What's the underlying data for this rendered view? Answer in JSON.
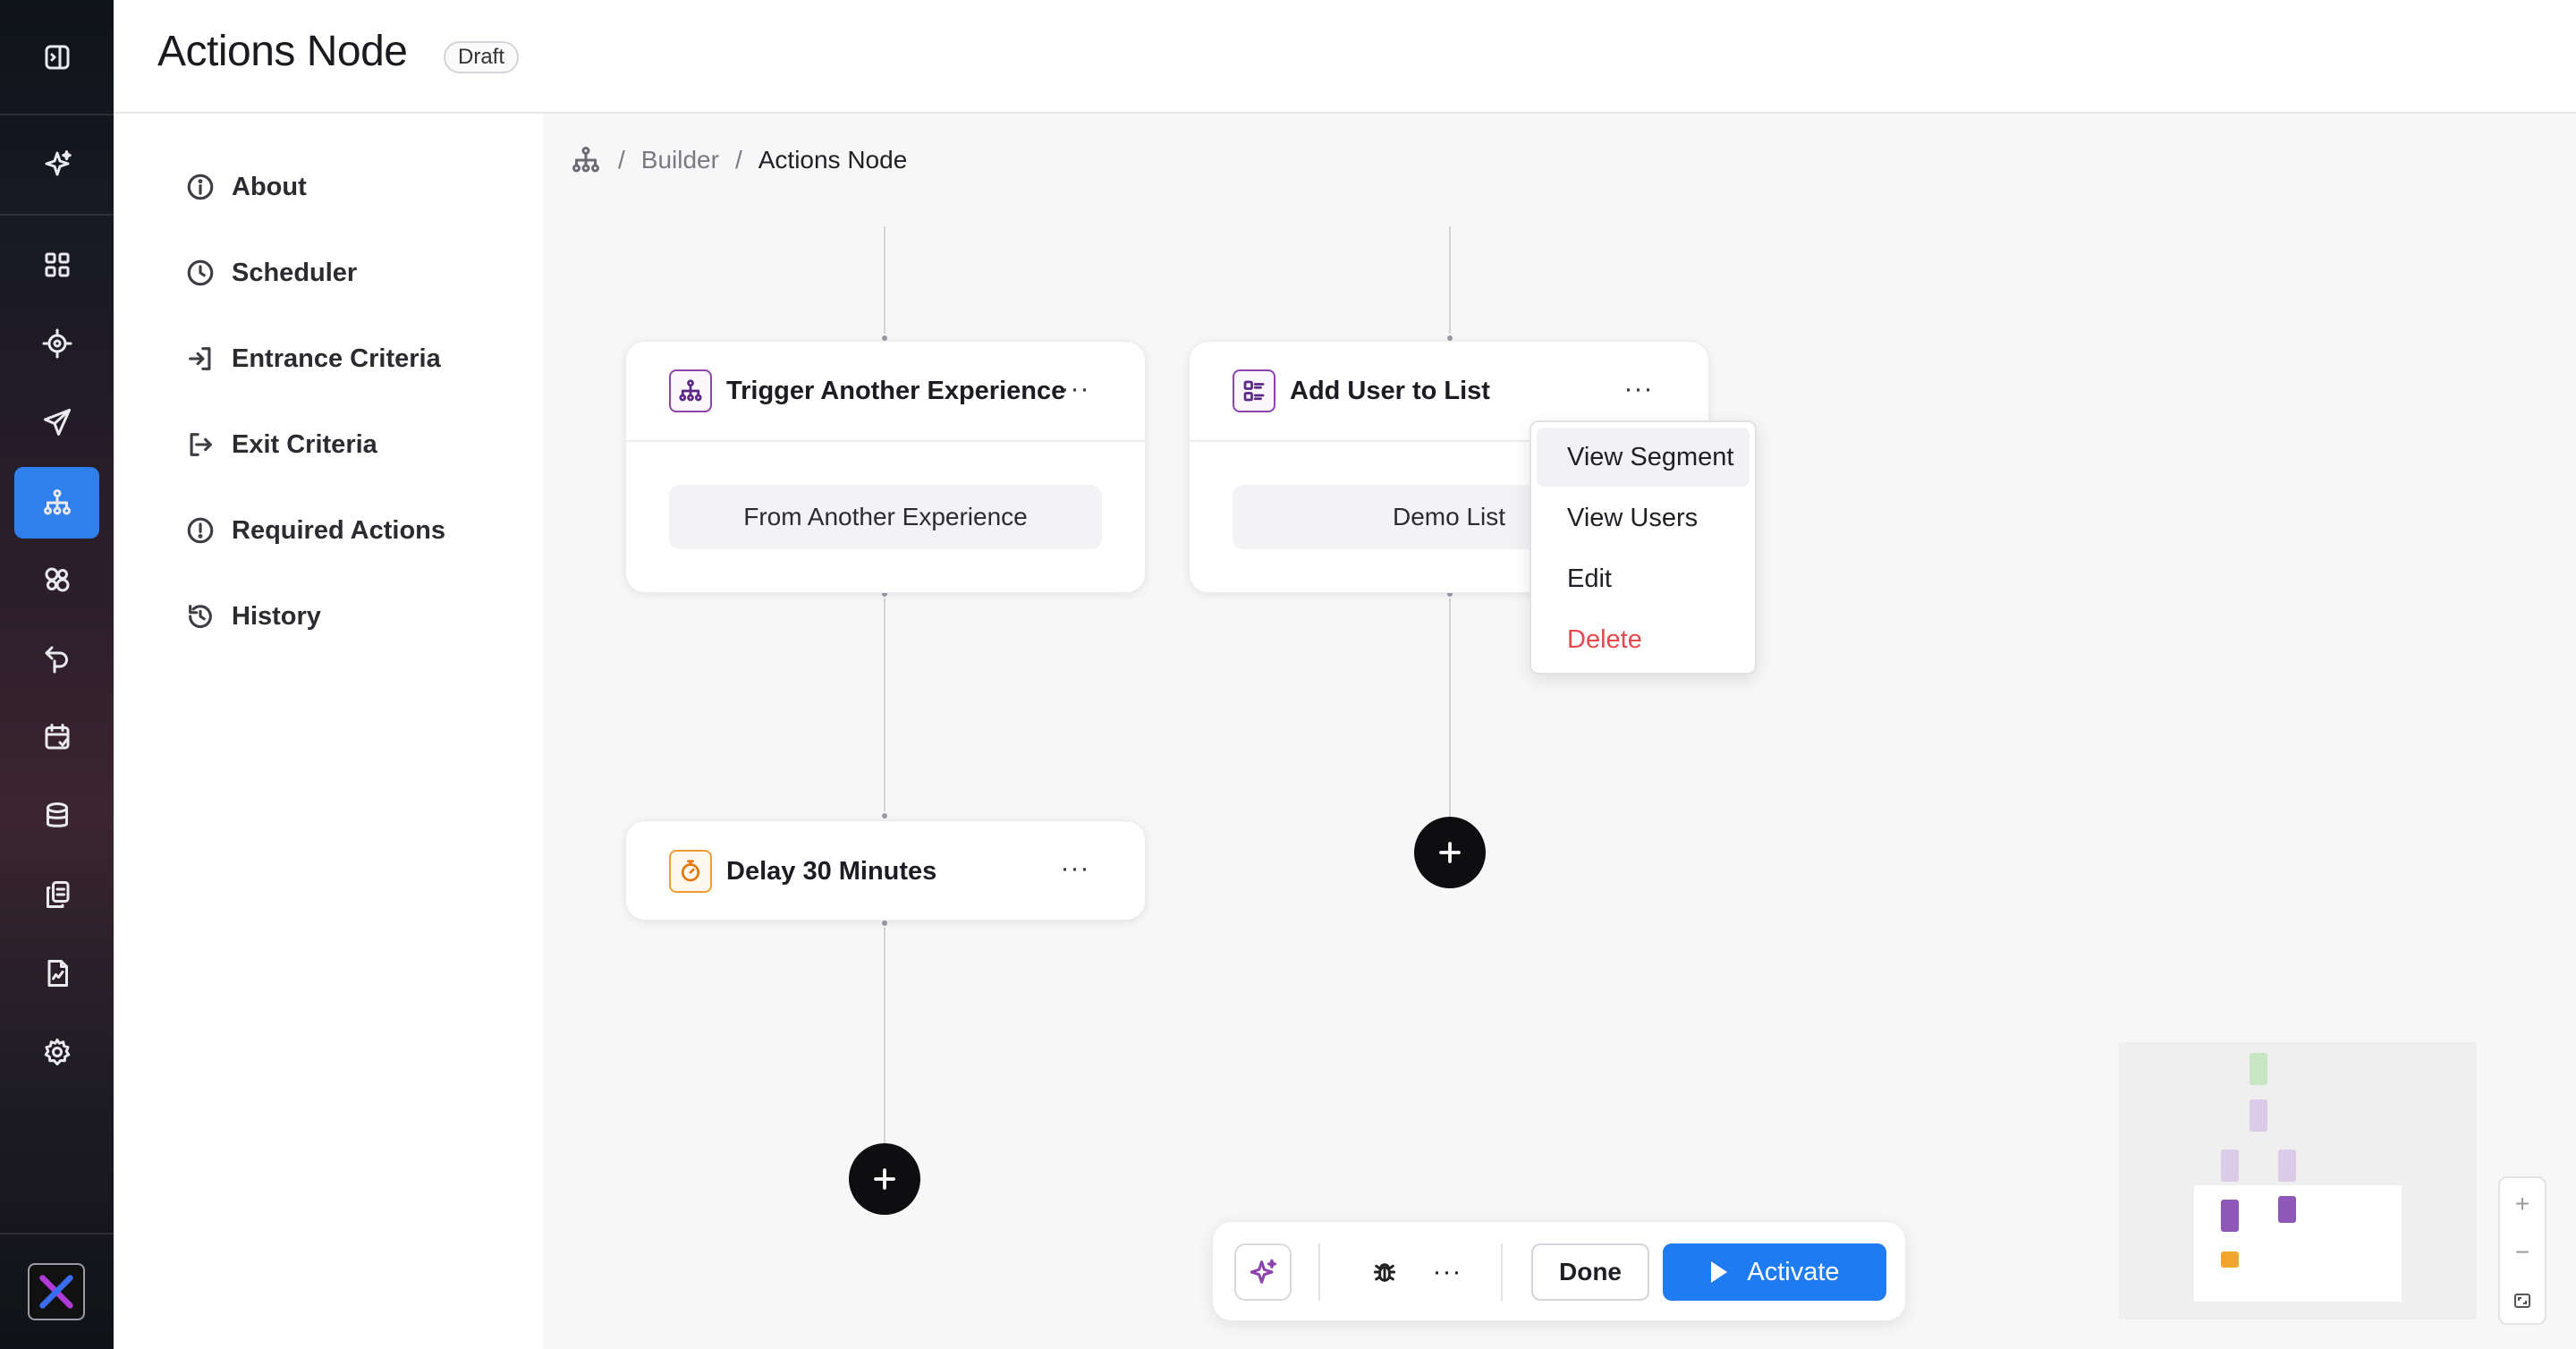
{
  "page": {
    "title": "Actions Node",
    "status_badge": "Draft"
  },
  "rail": {
    "items": [
      {
        "icon": "sidebar-toggle-icon"
      },
      {
        "icon": "sparkles-icon"
      },
      {
        "icon": "dashboard-grid-icon"
      },
      {
        "icon": "target-icon"
      },
      {
        "icon": "send-icon"
      },
      {
        "icon": "hierarchy-icon",
        "active": true
      },
      {
        "icon": "components-icon"
      },
      {
        "icon": "journey-icon"
      },
      {
        "icon": "calendar-icon"
      },
      {
        "icon": "database-icon"
      },
      {
        "icon": "copy-stack-icon"
      },
      {
        "icon": "report-icon"
      },
      {
        "icon": "settings-gear-icon"
      }
    ],
    "logo": "brand-logo-icon",
    "accent": "#2f80ed"
  },
  "leftnav": {
    "items": [
      {
        "label": "About",
        "icon": "info-circle-icon"
      },
      {
        "label": "Scheduler",
        "icon": "clock-icon"
      },
      {
        "label": "Entrance Criteria",
        "icon": "enter-icon"
      },
      {
        "label": "Exit Criteria",
        "icon": "exit-icon"
      },
      {
        "label": "Required Actions",
        "icon": "alert-circle-icon"
      },
      {
        "label": "History",
        "icon": "history-icon"
      }
    ]
  },
  "breadcrumb": {
    "icon": "hierarchy-icon",
    "items": [
      "Builder",
      "Actions Node"
    ],
    "separator": "/"
  },
  "nodes": {
    "trigger": {
      "title": "Trigger Another Experience",
      "value": "From Another Experience",
      "more": "···",
      "icon": "hierarchy-icon"
    },
    "add_user": {
      "title": "Add User to List",
      "value": "Demo List",
      "more": "···",
      "icon": "list-icon"
    },
    "delay": {
      "title": "Delay 30 Minutes",
      "more": "···",
      "icon": "stopwatch-icon"
    }
  },
  "context_menu": {
    "items": [
      "View Segment",
      "View Users",
      "Edit",
      "Delete"
    ],
    "danger_color": "#e5484d"
  },
  "toolbar": {
    "more": "···",
    "done_label": "Done",
    "activate_label": "Activate",
    "activate_color": "#1f7bf2"
  },
  "zoom": {
    "in": "+",
    "out": "−"
  },
  "colors": {
    "node_icon_purple": "#8e44ad",
    "delay_icon_orange": "#f39c34"
  }
}
